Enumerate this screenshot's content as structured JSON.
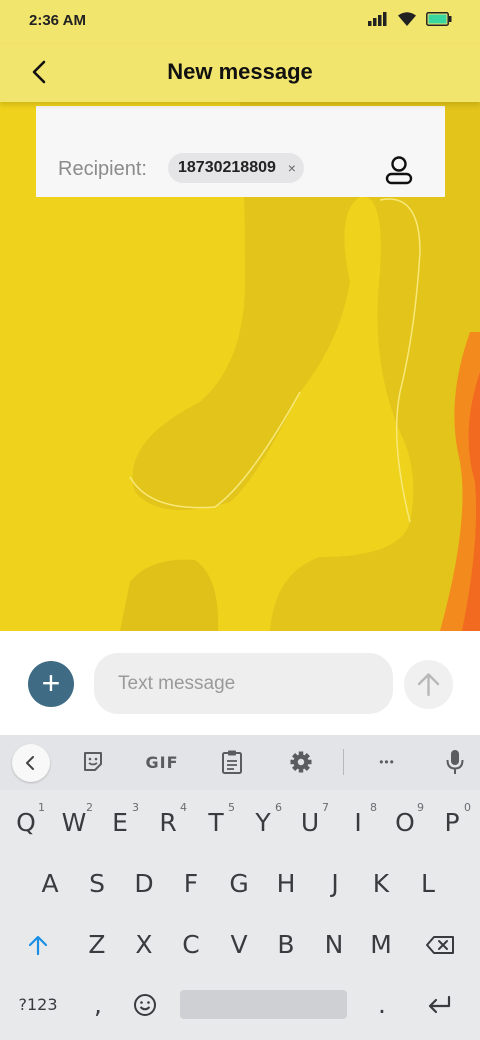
{
  "status": {
    "time": "2:36 AM",
    "icons": [
      "signal-icon",
      "wifi-icon",
      "battery-icon"
    ]
  },
  "header": {
    "title": "New message",
    "back_icon": "back-arrow-icon"
  },
  "recipient": {
    "label": "Recipient:",
    "chip_value": "18730218809",
    "chip_remove": "×",
    "contact_icon": "contact-person-icon"
  },
  "composer": {
    "add_label": "+",
    "placeholder": "Text message",
    "send_icon": "send-arrow-icon"
  },
  "keyboard_toolbar": {
    "gif_label": "GIF",
    "more_label": "•••",
    "tools": [
      "collapse-icon",
      "sticker-icon",
      "gif",
      "clipboard-icon",
      "settings-icon",
      "more-icon",
      "mic-icon"
    ]
  },
  "keyboard": {
    "row1": [
      {
        "k": "Q",
        "h": "1"
      },
      {
        "k": "W",
        "h": "2"
      },
      {
        "k": "E",
        "h": "3"
      },
      {
        "k": "R",
        "h": "4"
      },
      {
        "k": "T",
        "h": "5"
      },
      {
        "k": "Y",
        "h": "6"
      },
      {
        "k": "U",
        "h": "7"
      },
      {
        "k": "I",
        "h": "8"
      },
      {
        "k": "O",
        "h": "9"
      },
      {
        "k": "P",
        "h": "0"
      }
    ],
    "row2": [
      "A",
      "S",
      "D",
      "F",
      "G",
      "H",
      "J",
      "K",
      "L"
    ],
    "row3": [
      "Z",
      "X",
      "C",
      "V",
      "B",
      "N",
      "M"
    ],
    "symbols_label": "?123",
    "comma_label": ",",
    "period_label": "."
  },
  "colors": {
    "header": "#f2e56d",
    "wallpaper": "#efd21c",
    "accent": "#3f6c84",
    "shift": "#1a8fe3"
  }
}
